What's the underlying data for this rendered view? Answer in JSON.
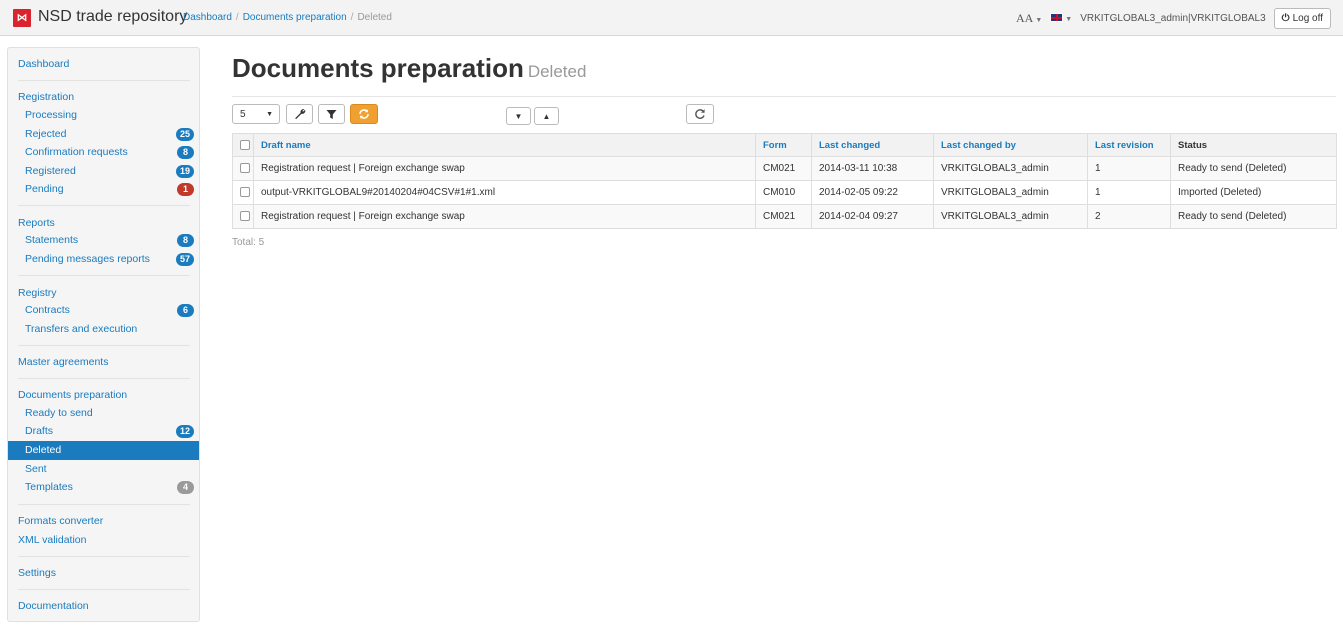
{
  "header": {
    "app_title": "NSD trade repository",
    "breadcrumb": [
      "Dashboard",
      "Documents preparation",
      "Deleted"
    ],
    "font_menu": "AA",
    "user": "VRKITGLOBAL3_admin",
    "org": "VRKITGLOBAL3",
    "logoff_label": "Log off"
  },
  "sidebar": {
    "dashboard": "Dashboard",
    "registration": "Registration",
    "processing": "Processing",
    "rejected": "Rejected",
    "rejected_count": "25",
    "confirmation_requests": "Confirmation requests",
    "confirmation_count": "8",
    "registered": "Registered",
    "registered_count": "19",
    "pending": "Pending",
    "pending_count": "1",
    "reports": "Reports",
    "statements": "Statements",
    "statements_count": "8",
    "pending_messages_reports": "Pending messages reports",
    "pending_messages_count": "57",
    "registry": "Registry",
    "contracts": "Contracts",
    "contracts_count": "6",
    "transfers": "Transfers and execution",
    "master_agreements": "Master agreements",
    "documents_preparation": "Documents preparation",
    "ready_to_send": "Ready to send",
    "drafts": "Drafts",
    "drafts_count": "12",
    "deleted": "Deleted",
    "sent": "Sent",
    "templates": "Templates",
    "templates_count": "4",
    "formats_converter": "Formats converter",
    "xml_validation": "XML validation",
    "settings": "Settings",
    "documentation": "Documentation"
  },
  "main": {
    "title": "Documents preparation",
    "subtitle": "Deleted",
    "page_size": "5",
    "total": "Total: 5",
    "columns": [
      "Draft name",
      "Form",
      "Last changed",
      "Last changed by",
      "Last revision",
      "Status"
    ],
    "rows": [
      [
        "Registration request | Foreign exchange swap",
        "CM021",
        "2014-03-11 10:38",
        "VRKITGLOBAL3_admin",
        "1",
        "Ready to send (Deleted)"
      ],
      [
        "output-VRKITGLOBAL9#20140204#04CSV#1#1.xml",
        "CM010",
        "2014-02-05 09:22",
        "VRKITGLOBAL3_admin",
        "1",
        "Imported (Deleted)"
      ],
      [
        "Registration request | Foreign exchange swap",
        "CM021",
        "2014-02-04 09:27",
        "VRKITGLOBAL3_admin",
        "2",
        "Ready to send (Deleted)"
      ]
    ]
  },
  "icons": {
    "settings": "wrench-icon",
    "filter": "filter-icon",
    "refresh": "sync-icon",
    "reload": "reload-icon",
    "sort_down": "caret-down-icon",
    "sort_up": "caret-up-icon"
  },
  "colors": {
    "link": "#1a7bbf",
    "active_nav": "#1a7bbf",
    "badge_red": "#c0392b",
    "logo": "#d9232e",
    "refresh_button": "#f0a030"
  }
}
